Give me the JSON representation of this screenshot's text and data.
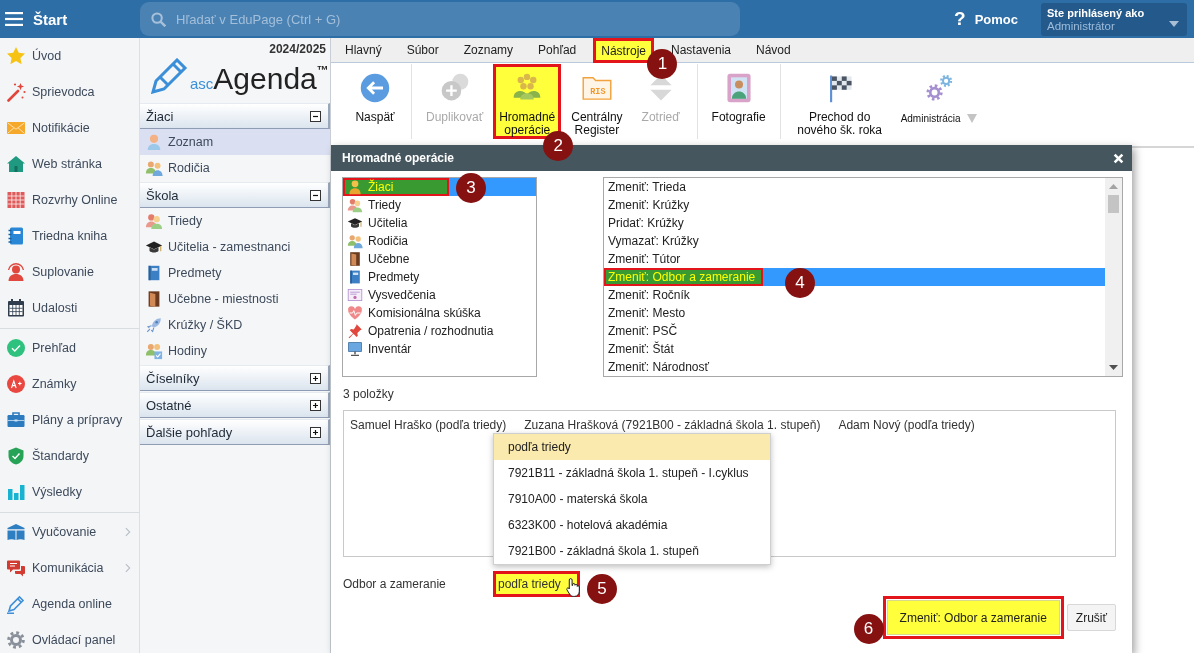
{
  "top_bar": {
    "title": "Štart",
    "search": {
      "placeholder": "Hľadať v EduPage (Ctrl + G)"
    },
    "help": {
      "symbol": "?",
      "label": "Pomoc"
    },
    "user": {
      "caption": "Ste prihlásený ako",
      "role": "Administrátor"
    }
  },
  "sidebar": {
    "groups": [
      {
        "items": [
          {
            "label": "Úvod",
            "has_submenu": false
          },
          {
            "label": "Sprievodca",
            "has_submenu": false
          },
          {
            "label": "Notifikácie",
            "has_submenu": false
          },
          {
            "label": "Web stránka",
            "has_submenu": false
          },
          {
            "label": "Rozvrhy Online",
            "has_submenu": false
          },
          {
            "label": "Triedna kniha",
            "has_submenu": false
          },
          {
            "label": "Suplovanie",
            "has_submenu": false
          },
          {
            "label": "Udalosti",
            "has_submenu": false
          }
        ]
      },
      {
        "items": [
          {
            "label": "Prehľad",
            "has_submenu": false
          },
          {
            "label": "Známky",
            "has_submenu": false
          },
          {
            "label": "Plány a prípravy",
            "has_submenu": false
          },
          {
            "label": "Štandardy",
            "has_submenu": false
          },
          {
            "label": "Výsledky",
            "has_submenu": false
          }
        ]
      },
      {
        "items": [
          {
            "label": "Vyučovanie",
            "has_submenu": true
          },
          {
            "label": "Komunikácia",
            "has_submenu": true
          },
          {
            "label": "Agenda online",
            "has_submenu": false
          },
          {
            "label": "Ovládací panel",
            "has_submenu": false
          }
        ]
      }
    ]
  },
  "agenda_nav": {
    "year": "2024/2025",
    "logo": {
      "prefix": "asc",
      "name": "Agenda",
      "mark": "™"
    },
    "sections": [
      {
        "title": "Žiaci",
        "expanded": true,
        "items": [
          {
            "label": "Zoznam",
            "selected": true
          },
          {
            "label": "Rodičia",
            "selected": false
          }
        ]
      },
      {
        "title": "Škola",
        "expanded": true,
        "items": [
          {
            "label": "Triedy",
            "selected": false
          },
          {
            "label": "Učitelia - zamestnanci",
            "selected": false
          },
          {
            "label": "Predmety",
            "selected": false
          },
          {
            "label": "Učebne - miestnosti",
            "selected": false
          },
          {
            "label": "Krúžky / ŠKD",
            "selected": false
          },
          {
            "label": "Hodiny",
            "selected": false
          }
        ]
      },
      {
        "title": "Číselníky",
        "expanded": false
      },
      {
        "title": "Ostatné",
        "expanded": false
      },
      {
        "title": "Ďalšie pohľady",
        "expanded": false
      }
    ]
  },
  "menu_tabs": [
    {
      "label": "Hlavný",
      "selected": false,
      "highlighted": false
    },
    {
      "label": "Súbor",
      "selected": false,
      "highlighted": false
    },
    {
      "label": "Zoznamy",
      "selected": false,
      "highlighted": false
    },
    {
      "label": "Pohľad",
      "selected": false,
      "highlighted": false
    },
    {
      "label": "Nástroje",
      "selected": true,
      "highlighted": true,
      "callout": "1"
    },
    {
      "label": "Nastavenia",
      "selected": false,
      "highlighted": false
    },
    {
      "label": "Návod",
      "selected": false,
      "highlighted": false
    }
  ],
  "toolbar": {
    "groups": [
      {
        "buttons": [
          {
            "kind": "button",
            "label": "Naspäť",
            "disabled": false,
            "highlighted": false
          }
        ]
      },
      {
        "buttons": [
          {
            "kind": "button",
            "label": "Duplikovať",
            "disabled": true,
            "highlighted": false
          },
          {
            "kind": "button",
            "label": "Hromadné operácie",
            "disabled": false,
            "highlighted": true,
            "callout": "2"
          },
          {
            "kind": "button",
            "label": "Centrálny Register",
            "icon_text": "RIS",
            "disabled": false,
            "highlighted": false
          },
          {
            "kind": "button",
            "label": "Zotrieď",
            "disabled": true,
            "highlighted": false
          }
        ]
      },
      {
        "buttons": [
          {
            "kind": "button",
            "label": "Fotografie",
            "disabled": false,
            "highlighted": false
          }
        ]
      },
      {
        "buttons": [
          {
            "kind": "button",
            "label": "Prechod do nového šk. roka",
            "disabled": false,
            "highlighted": false
          },
          {
            "kind": "dropdown",
            "label": "Administrácia",
            "disabled": false,
            "highlighted": false
          }
        ]
      }
    ]
  },
  "dialog": {
    "title": "Hromadné operácie",
    "categories": [
      {
        "label": "Žiaci",
        "selected": true,
        "highlighted": true,
        "callout": "3"
      },
      {
        "label": "Triedy",
        "selected": false,
        "highlighted": false
      },
      {
        "label": "Učitelia",
        "selected": false,
        "highlighted": false
      },
      {
        "label": "Rodičia",
        "selected": false,
        "highlighted": false
      },
      {
        "label": "Učebne",
        "selected": false,
        "highlighted": false
      },
      {
        "label": "Predmety",
        "selected": false,
        "highlighted": false
      },
      {
        "label": "Vysvedčenia",
        "selected": false,
        "highlighted": false
      },
      {
        "label": "Komisionálna skúška",
        "selected": false,
        "highlighted": false
      },
      {
        "label": "Opatrenia / rozhodnutia",
        "selected": false,
        "highlighted": false
      },
      {
        "label": "Inventár",
        "selected": false,
        "highlighted": false
      }
    ],
    "operations": [
      {
        "label": "Zmeniť: Trieda",
        "selected": false,
        "highlighted": false
      },
      {
        "label": "Zmeniť: Krúžky",
        "selected": false,
        "highlighted": false
      },
      {
        "label": "Pridať: Krúžky",
        "selected": false,
        "highlighted": false
      },
      {
        "label": "Vymazať: Krúžky",
        "selected": false,
        "highlighted": false
      },
      {
        "label": "Zmeniť: Tútor",
        "selected": false,
        "highlighted": false
      },
      {
        "label": "Zmeniť: Odbor a zameranie",
        "selected": true,
        "highlighted": true,
        "callout": "4"
      },
      {
        "label": "Zmeniť: Ročník",
        "selected": false,
        "highlighted": false
      },
      {
        "label": "Zmeniť: Mesto",
        "selected": false,
        "highlighted": false
      },
      {
        "label": "Zmeniť: PSČ",
        "selected": false,
        "highlighted": false
      },
      {
        "label": "Zmeniť: Štát",
        "selected": false,
        "highlighted": false
      },
      {
        "label": "Zmeniť: Národnosť",
        "selected": false,
        "highlighted": false
      }
    ],
    "count": "3 položky",
    "selected_items": [
      "Samuel Hraško (podľa triedy)",
      "Zuzana Hrašková (7921B00 - základná škola 1. stupeň)",
      "Adam Nový (podľa triedy)"
    ],
    "field": {
      "label": "Odbor a zameranie",
      "value": "podľa triedy",
      "highlighted": true,
      "expanded": true,
      "callout": "5",
      "options": [
        {
          "label": "podľa triedy",
          "selected": true
        },
        {
          "label": "7921B11 - základná škola 1. stupeň - I.cyklus",
          "selected": false
        },
        {
          "label": "7910A00 - materská škola",
          "selected": false
        },
        {
          "label": "6323K00 - hotelová akadémia",
          "selected": false
        },
        {
          "label": "7921B00 - základná škola 1. stupeň",
          "selected": false
        }
      ]
    },
    "buttons": [
      {
        "label": "Zmeniť: Odbor a zameranie",
        "highlighted": true,
        "callout": "6"
      },
      {
        "label": "Zrušiť",
        "highlighted": false
      }
    ]
  }
}
